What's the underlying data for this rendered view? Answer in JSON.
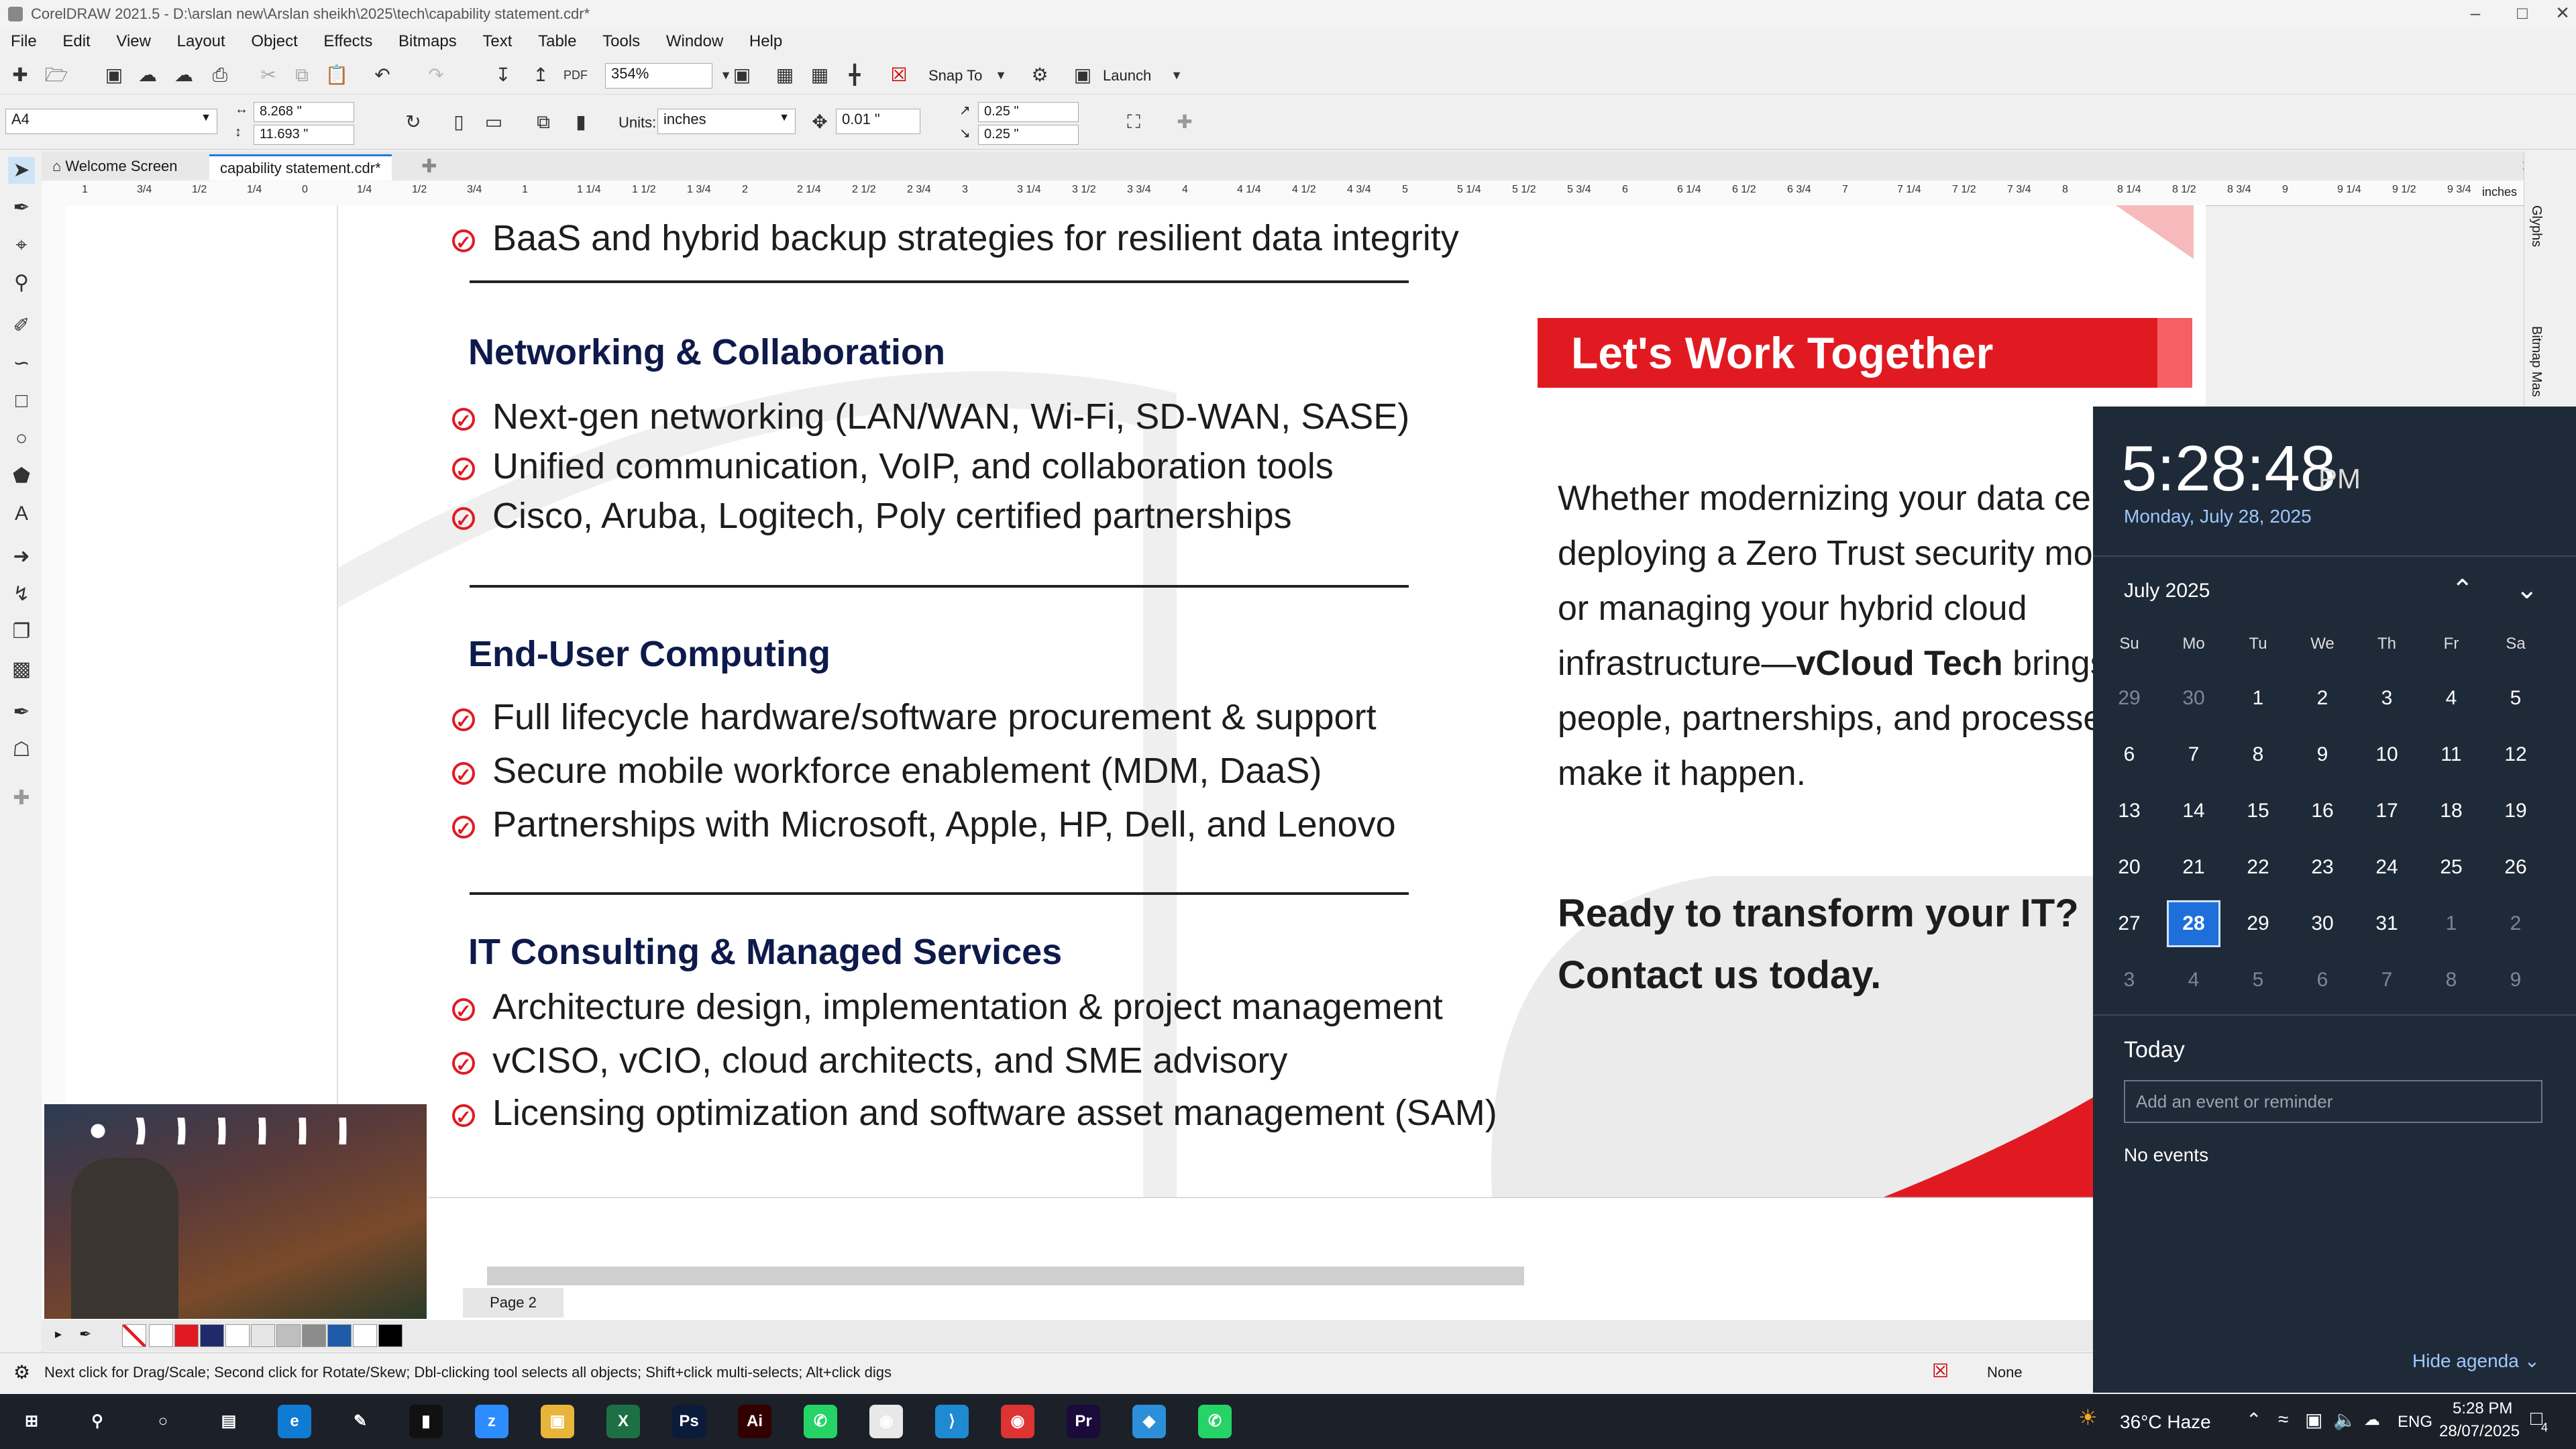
{
  "window": {
    "title": "CorelDRAW 2021.5 - D:\\arslan new\\Arslan sheikh\\2025\\tech\\capability statement.cdr*"
  },
  "menu": [
    "File",
    "Edit",
    "View",
    "Layout",
    "Object",
    "Effects",
    "Bitmaps",
    "Text",
    "Table",
    "Tools",
    "Window",
    "Help"
  ],
  "toolbar": {
    "zoom": "354%",
    "snap_label": "Snap To",
    "launch_label": "Launch",
    "page_size": "A4",
    "width": "8.268 \"",
    "height": "11.693 \"",
    "units_label": "Units:",
    "units_value": "inches",
    "nudge": "0.01 \"",
    "dup_x": "0.25 \"",
    "dup_y": "0.25 \""
  },
  "tabs": {
    "welcome": "Welcome Screen",
    "document": "capability statement.cdr*"
  },
  "ruler": {
    "unit": "inches",
    "ticks": [
      "1",
      "3/4",
      "1/2",
      "1/4",
      "0",
      "1/4",
      "1/2",
      "3/4",
      "1",
      "1 1/4",
      "1 1/2",
      "1 3/4",
      "2",
      "2 1/4",
      "2 1/2",
      "2 3/4",
      "3",
      "3 1/4",
      "3 1/2",
      "3 3/4",
      "4",
      "4 1/4",
      "4 1/2",
      "4 3/4",
      "5",
      "5 1/4",
      "5 1/2",
      "5 3/4",
      "6",
      "6 1/4",
      "6 1/2",
      "6 3/4",
      "7",
      "7 1/4",
      "7 1/2",
      "7 3/4",
      "8",
      "8 1/4",
      "8 1/2",
      "8 3/4",
      "9",
      "9 1/4",
      "9 1/2",
      "9 3/4"
    ]
  },
  "document": {
    "top_bullet": "BaaS and hybrid backup strategies for resilient data integrity",
    "sections": [
      {
        "heading": "Networking & Collaboration",
        "bullets": [
          "Next-gen networking (LAN/WAN, Wi-Fi, SD-WAN, SASE)",
          "Unified communication, VoIP, and collaboration tools",
          "Cisco, Aruba, Logitech, Poly certified partnerships"
        ]
      },
      {
        "heading": "End-User Computing",
        "bullets": [
          "Full lifecycle hardware/software procurement & support",
          "Secure mobile workforce enablement (MDM, DaaS)",
          "Partnerships with Microsoft, Apple, HP, Dell, and Lenovo"
        ]
      },
      {
        "heading": "IT Consulting & Managed Services",
        "bullets": [
          "Architecture design, implementation & project management",
          "vCISO, vCIO, cloud architects, and SME advisory",
          "Licensing optimization and software asset management (SAM)"
        ]
      }
    ],
    "banner": "Let's Work Together",
    "paragraph_lines": [
      "Whether modernizing your data ce",
      "deploying a Zero Trust security mo",
      "or managing your hybrid cloud",
      "infrastructure—",
      "people, partnerships, and processe",
      "make it happen."
    ],
    "brand": "vCloud Tech",
    "brand_suffix": " brings",
    "cta_line1": "Ready to transform your IT?",
    "cta_line2": "Contact us today."
  },
  "page_tab": "Page 2",
  "side_docker": {
    "glyphs": "Glyphs",
    "bitmap_mask": "Bitmap Mas"
  },
  "status": {
    "hint": "Next click for Drag/Scale; Second click for Rotate/Skew; Dbl-clicking tool selects all objects; Shift+click multi-selects; Alt+click digs",
    "fill": "None"
  },
  "palette_colors": [
    "#ffffff",
    "#e11a22",
    "#1f2a6b",
    "#ffffff",
    "#e6e6e6",
    "#bfbfbf",
    "#8c8c8c",
    "#1e5aa8",
    "#ffffff",
    "#000000"
  ],
  "calendar": {
    "time": "5:28:48",
    "ampm": "PM",
    "date": "Monday, July 28, 2025",
    "month": "July 2025",
    "day_names": [
      "Su",
      "Mo",
      "Tu",
      "We",
      "Th",
      "Fr",
      "Sa"
    ],
    "weeks": [
      [
        "29",
        "30",
        "1",
        "2",
        "3",
        "4",
        "5"
      ],
      [
        "6",
        "7",
        "8",
        "9",
        "10",
        "11",
        "12"
      ],
      [
        "13",
        "14",
        "15",
        "16",
        "17",
        "18",
        "19"
      ],
      [
        "20",
        "21",
        "22",
        "23",
        "24",
        "25",
        "26"
      ],
      [
        "27",
        "28",
        "29",
        "30",
        "31",
        "1",
        "2"
      ],
      [
        "3",
        "4",
        "5",
        "6",
        "7",
        "8",
        "9"
      ]
    ],
    "today_label": "Today",
    "event_placeholder": "Add an event or reminder",
    "no_events": "No events",
    "hide_agenda": "Hide agenda"
  },
  "taskbar": {
    "weather": "36°C  Haze",
    "lang": "ENG",
    "time": "5:28 PM",
    "date": "28/07/2025",
    "notification_count": "4",
    "apps": [
      "start",
      "search",
      "cortana",
      "task-view",
      "edge",
      "pen",
      "terminal",
      "zoom",
      "explorer",
      "excel",
      "photoshop",
      "illustrator",
      "whatsapp",
      "chrome",
      "vscode",
      "chrome-profile",
      "premiere",
      "app-blue",
      "whatsapp-2"
    ]
  }
}
